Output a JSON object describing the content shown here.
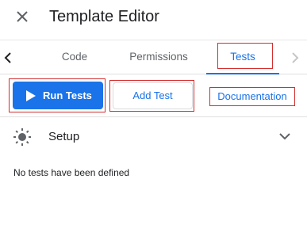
{
  "header": {
    "title": "Template Editor",
    "close_icon": "close-icon"
  },
  "tabs": [
    {
      "label": "Code",
      "active": false
    },
    {
      "label": "Permissions",
      "active": false
    },
    {
      "label": "Tests",
      "active": true
    }
  ],
  "actions": {
    "run_label": "Run Tests",
    "add_label": "Add Test",
    "docs_label": "Documentation"
  },
  "setup": {
    "label": "Setup",
    "icon": "sun-icon",
    "expanded": false
  },
  "tests": {
    "empty_message": "No tests have been defined"
  },
  "colors": {
    "accent": "#1a73e8",
    "highlight": "#d32f2f",
    "text": "#202124",
    "muted": "#5f6368"
  }
}
